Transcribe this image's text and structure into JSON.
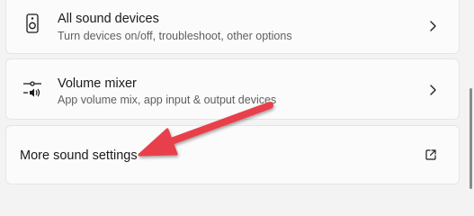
{
  "sound_devices": {
    "title": "All sound devices",
    "subtitle": "Turn devices on/off, troubleshoot, other options",
    "icon": "speaker-icon"
  },
  "volume_mixer": {
    "title": "Volume mixer",
    "subtitle": "App volume mix, app input & output devices",
    "icon": "volume-mixer-icon"
  },
  "more_settings": {
    "title": "More sound settings",
    "icon": "external-link-icon"
  },
  "colors": {
    "annotation_arrow": "#e8414b",
    "card_background": "#fbfbfb",
    "page_background": "#f3f3f3"
  }
}
